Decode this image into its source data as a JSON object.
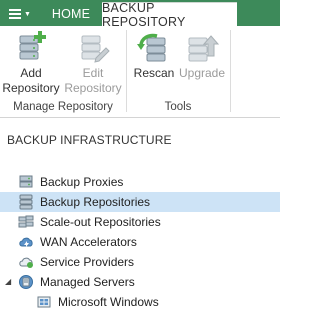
{
  "tabs": {
    "home": "HOME",
    "backup_repository": "BACKUP REPOSITORY"
  },
  "ribbon": {
    "add": "Add Repository",
    "edit": "Edit Repository",
    "rescan": "Rescan",
    "upgrade": "Upgrade",
    "group_manage": "Manage Repository",
    "group_tools": "Tools"
  },
  "section_title": "BACKUP INFRASTRUCTURE",
  "tree": {
    "items": [
      {
        "label": "Backup Proxies",
        "icon": "backup-proxy-icon"
      },
      {
        "label": "Backup Repositories",
        "icon": "backup-repository-icon",
        "selected": true
      },
      {
        "label": "Scale-out Repositories",
        "icon": "scale-out-repository-icon"
      },
      {
        "label": "WAN Accelerators",
        "icon": "wan-accelerator-icon"
      },
      {
        "label": "Service Providers",
        "icon": "service-provider-icon"
      },
      {
        "label": "Managed Servers",
        "icon": "managed-servers-icon",
        "expanded": true
      },
      {
        "label": "Microsoft Windows",
        "icon": "microsoft-windows-icon"
      }
    ]
  },
  "colors": {
    "tabbar": "#3d8a5a",
    "selection": "#cde3f6",
    "accent_green": "#4fae4a"
  }
}
